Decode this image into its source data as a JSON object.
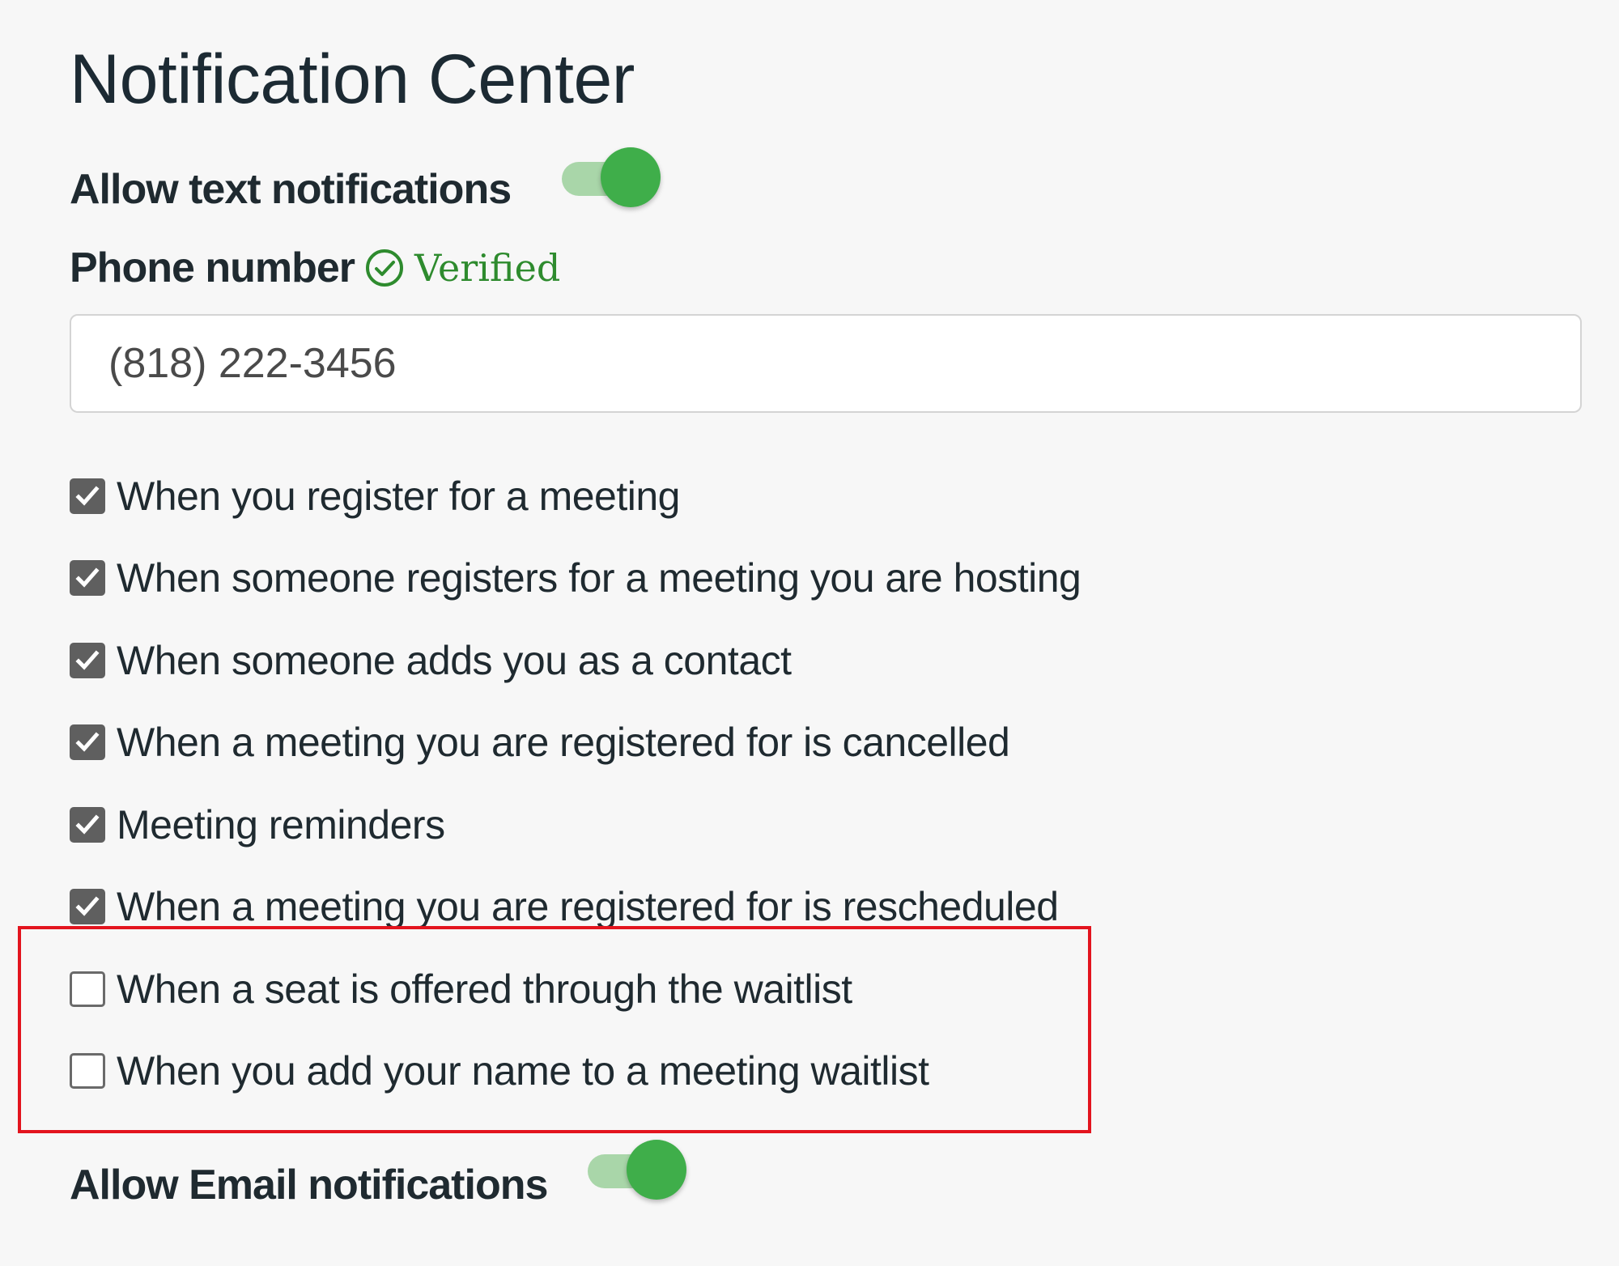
{
  "page": {
    "title": "Notification Center"
  },
  "text_notifications": {
    "label": "Allow text notifications",
    "enabled": true
  },
  "phone": {
    "label": "Phone number",
    "status_icon": "check-circle-icon",
    "status_text": "Verified",
    "value": "(818) 222-3456"
  },
  "options": [
    {
      "label": "When you register for a meeting",
      "checked": true
    },
    {
      "label": "When someone registers for a meeting you are hosting",
      "checked": true
    },
    {
      "label": "When someone adds you as a contact",
      "checked": true
    },
    {
      "label": "When a meeting you are registered for is cancelled",
      "checked": true
    },
    {
      "label": "Meeting reminders",
      "checked": true
    },
    {
      "label": "When a meeting you are registered for is rescheduled",
      "checked": true
    },
    {
      "label": "When a seat is offered through the waitlist",
      "checked": false
    },
    {
      "label": "When you add your name to a meeting waitlist",
      "checked": false
    }
  ],
  "email_notifications": {
    "label": "Allow Email notifications",
    "enabled": true
  },
  "colors": {
    "toggle_on_knob": "#3fae4a",
    "toggle_on_track": "#a9d6a9",
    "verified_green": "#2e8b2e",
    "highlight_red": "#e3141e",
    "checkbox_checked": "#5f5f5f"
  }
}
